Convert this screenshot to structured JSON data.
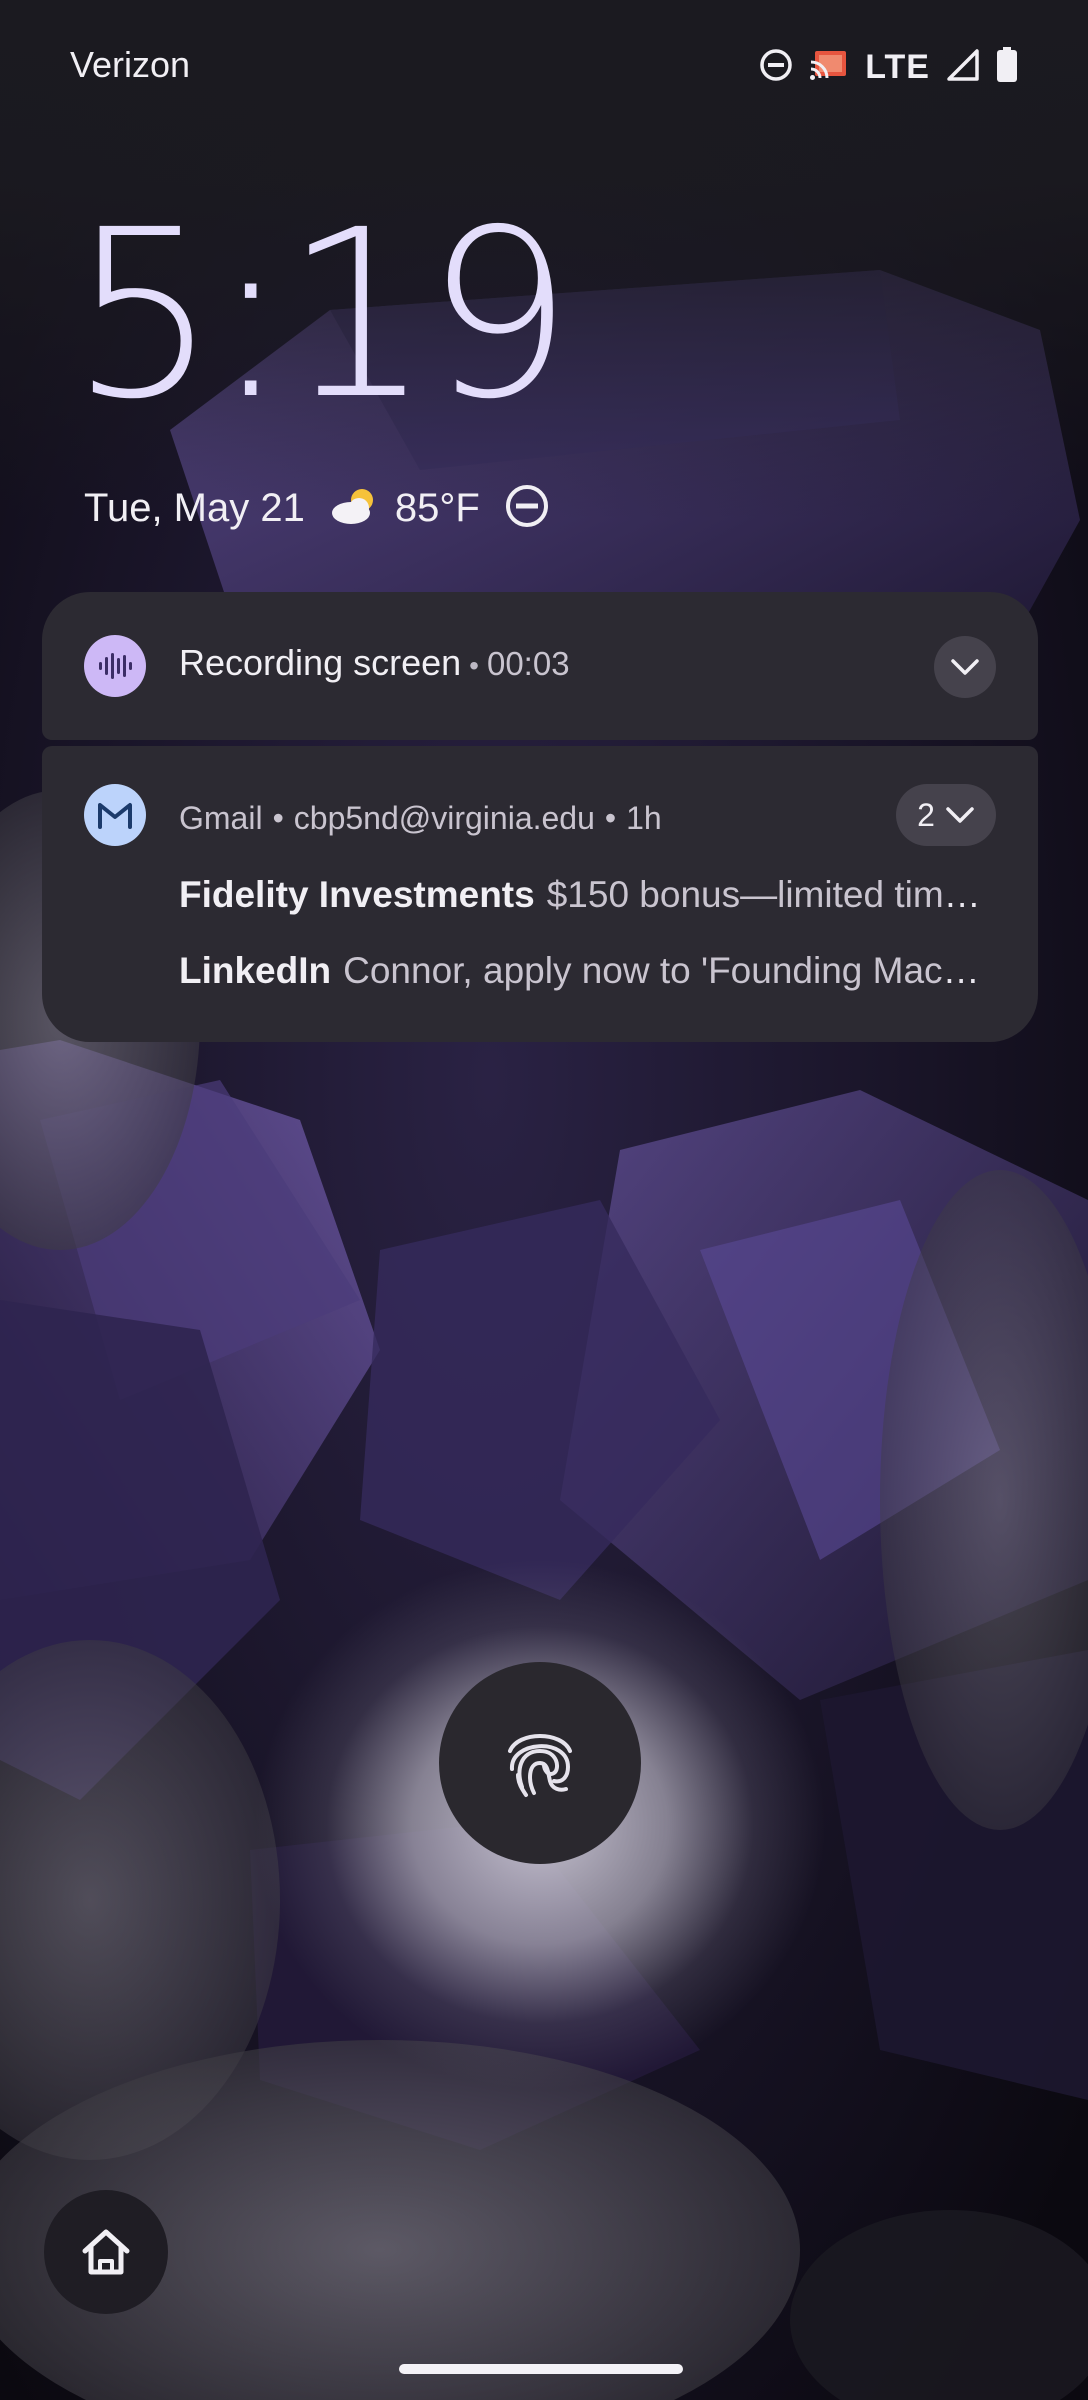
{
  "status_bar": {
    "carrier": "Verizon",
    "network": "LTE",
    "icons": [
      "do-not-disturb-icon",
      "cast-icon",
      "signal-icon",
      "battery-icon"
    ]
  },
  "clock": {
    "time": "5:19"
  },
  "date_row": {
    "date": "Tue, May 21",
    "weather_icon": "partly-cloudy-icon",
    "temperature": "85°F",
    "dnd_icon": "do-not-disturb-icon"
  },
  "notifications": {
    "recording": {
      "title": "Recording screen",
      "separator": "•",
      "elapsed": "00:03"
    },
    "gmail": {
      "app": "Gmail",
      "separator": "•",
      "account": "cbp5nd@virginia.edu",
      "age": "1h",
      "count": "2",
      "messages": [
        {
          "sender": "Fidelity Investments",
          "subject": "$150 bonus—limited time..."
        },
        {
          "sender": "LinkedIn",
          "subject": "Connor, apply now to 'Founding Mach..."
        }
      ]
    }
  },
  "colors": {
    "clock": "#e3ddfb",
    "card_background": "#2c2a32",
    "recording_icon_bg": "#cdb8f6",
    "gmail_icon_bg": "#bcd3fb"
  }
}
